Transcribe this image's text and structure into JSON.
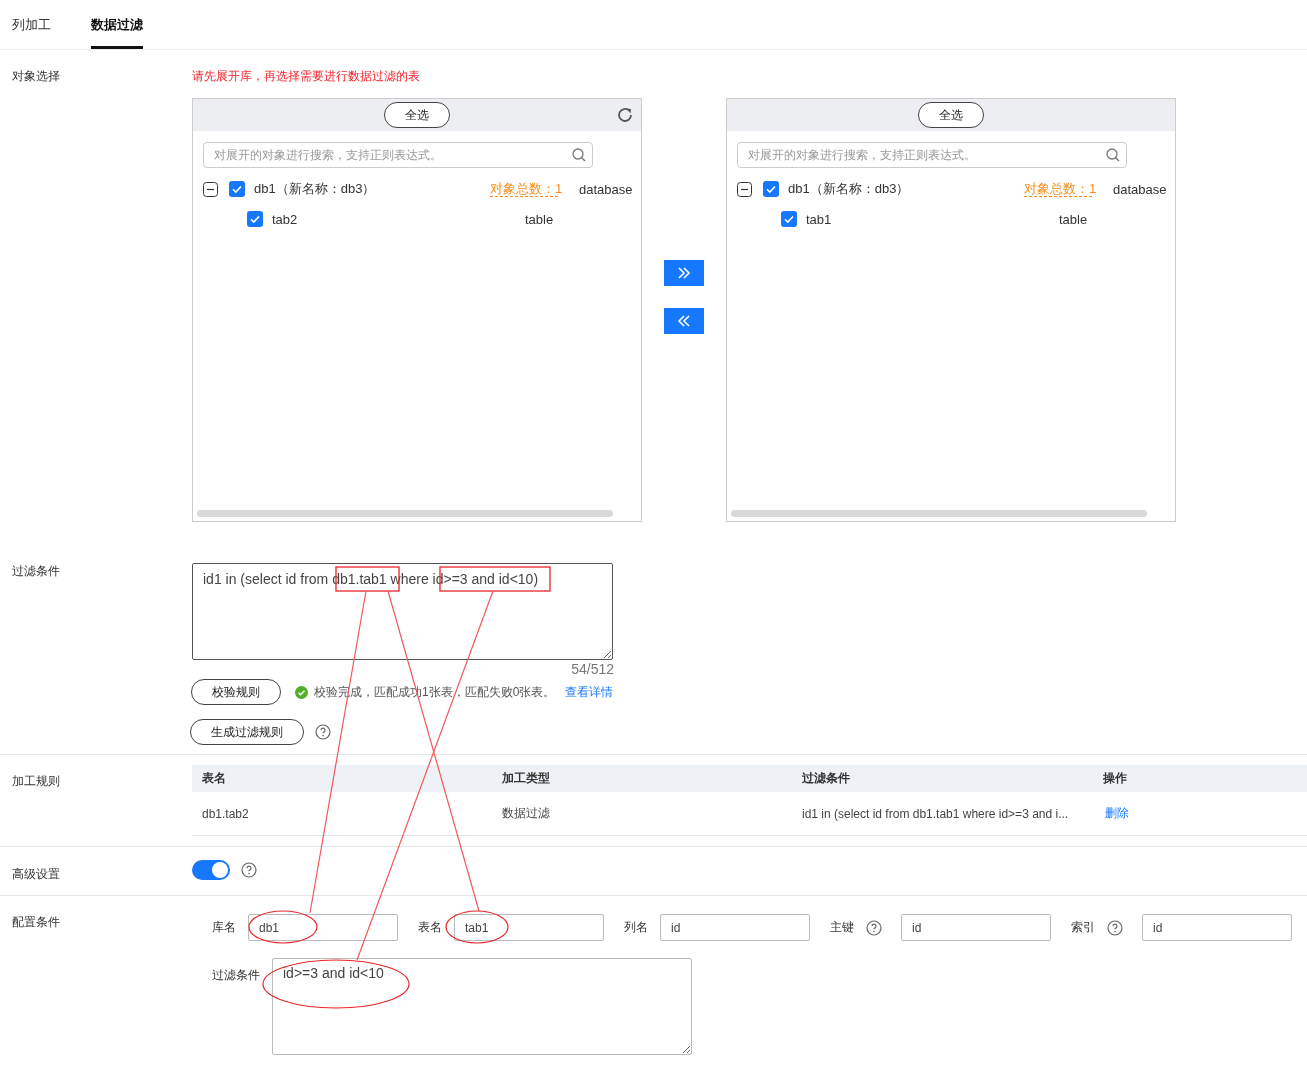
{
  "tabs": [
    {
      "label": "列加工",
      "selected": false
    },
    {
      "label": "数据过滤",
      "selected": true
    }
  ],
  "object_selection": {
    "label": "对象选择",
    "hint": "请先展开库，再选择需要进行数据过滤的表",
    "panels": [
      {
        "select_all": "全选",
        "refresh": true,
        "search_placeholder": "对展开的对象进行搜索，支持正则表达式。",
        "database": {
          "name": "db1（新名称：db3）",
          "expanded": true,
          "checked": true,
          "count": "对象总数：1",
          "type": "database",
          "tables": [
            {
              "name": "tab2",
              "checked": true,
              "type": "table"
            }
          ]
        }
      },
      {
        "select_all": "全选",
        "refresh": false,
        "search_placeholder": "对展开的对象进行搜索，支持正则表达式。",
        "database": {
          "name": "db1（新名称：db3）",
          "expanded": true,
          "checked": true,
          "count": "对象总数：1",
          "type": "database",
          "tables": [
            {
              "name": "tab1",
              "checked": true,
              "type": "table"
            }
          ]
        }
      }
    ]
  },
  "filter": {
    "label": "过滤条件",
    "value": "id1 in (select id from db1.tab1 where id>=3 and id<10)",
    "counter": "54/512",
    "validate_button": "校验规则",
    "status": "校验完成，匹配成功1张表，匹配失败0张表。",
    "details_link": "查看详情",
    "generate_button": "生成过滤规则"
  },
  "rules": {
    "label": "加工规则",
    "columns": [
      "表名",
      "加工类型",
      "过滤条件",
      "操作"
    ],
    "rows": [
      {
        "table": "db1.tab2",
        "type": "数据过滤",
        "condition": "id1 in (select id from db1.tab1 where id>=3 and i...",
        "action": "删除"
      }
    ]
  },
  "advanced": {
    "label": "高级设置",
    "on": true
  },
  "config": {
    "label": "配置条件",
    "fields": [
      {
        "label": "库名",
        "help": false,
        "value": "db1"
      },
      {
        "label": "表名",
        "help": false,
        "value": "tab1"
      },
      {
        "label": "列名",
        "help": false,
        "value": "id"
      },
      {
        "label": "主键",
        "help": true,
        "value": "id"
      },
      {
        "label": "索引",
        "help": true,
        "value": "id"
      }
    ],
    "filter_label": "过滤条件",
    "filter_value": "id>=3 and id<10"
  }
}
